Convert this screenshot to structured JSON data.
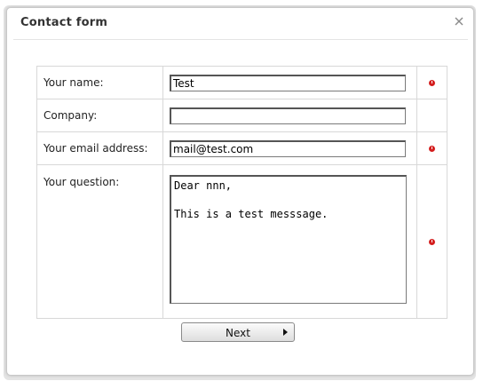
{
  "dialog": {
    "title": "Contact form"
  },
  "form": {
    "fields": [
      {
        "label": "Your name:",
        "value": "Test",
        "required": true
      },
      {
        "label": "Company:",
        "value": "",
        "required": false
      },
      {
        "label": "Your email address:",
        "value": "mail@test.com",
        "required": true
      },
      {
        "label": "Your question:",
        "value": "Dear nnn,\n\nThis is a test messsage.",
        "required": true
      }
    ],
    "next_label": "Next"
  },
  "colors": {
    "required_marker": "#d41e1e",
    "border": "#d8d8d8"
  },
  "icons": {
    "close": "close-icon",
    "required": "required-field-icon",
    "next": "arrow-right-icon"
  }
}
